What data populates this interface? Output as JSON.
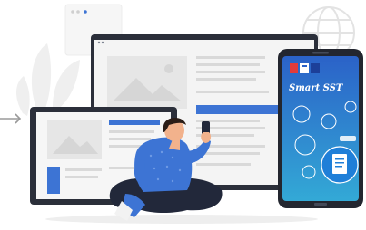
{
  "illustration": {
    "app_name": "Smart SST",
    "colors": {
      "accent": "#2f6fd1",
      "monitor_frame": "#2b2f3a",
      "screen_bg": "#f3f3f3",
      "phone_frame": "#23262f",
      "phone_screen_top": "#2b62c8",
      "phone_screen_bottom": "#33a9d6",
      "person_shirt": "#3d74d4",
      "person_pants": "#22283a",
      "skin": "#f2b28c",
      "hair": "#2b1d17"
    }
  }
}
